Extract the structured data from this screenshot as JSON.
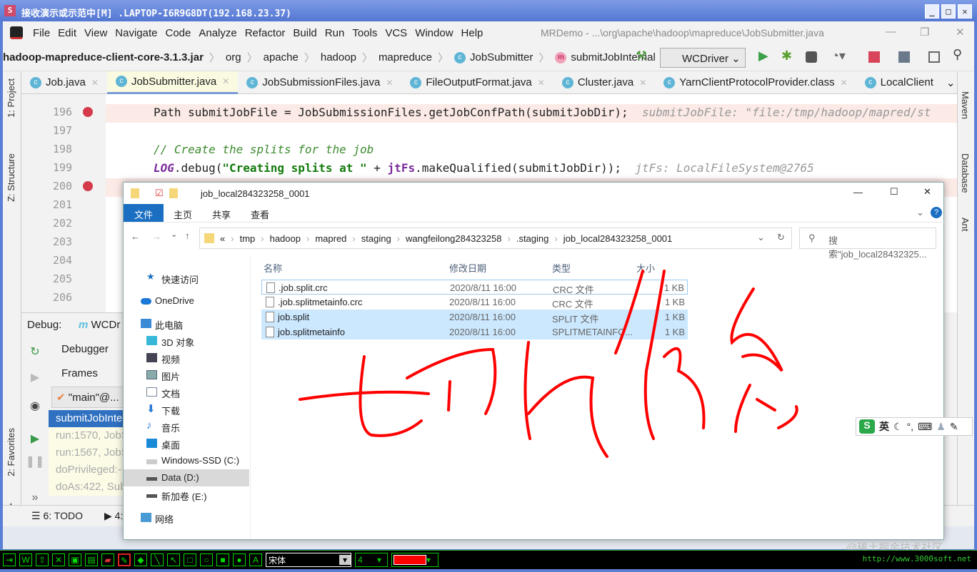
{
  "title": "接收演示或示范中[M] .LAPTOP-I6R9G8DT(192.168.23.37)",
  "menu": [
    "File",
    "Edit",
    "View",
    "Navigate",
    "Code",
    "Analyze",
    "Refactor",
    "Build",
    "Run",
    "Tools",
    "VCS",
    "Window",
    "Help"
  ],
  "project_path": "MRDemo - ...\\org\\apache\\hadoop\\mapreduce\\JobSubmitter.java",
  "breadcrumbs": [
    "hadoop-mapreduce-client-core-3.1.3.jar",
    "org",
    "apache",
    "hadoop",
    "mapreduce",
    "JobSubmitter",
    "submitJobInternal"
  ],
  "run_config": "WCDriver",
  "tabs": [
    "Job.java",
    "JobSubmitter.java",
    "JobSubmissionFiles.java",
    "FileOutputFormat.java",
    "Cluster.java",
    "YarnClientProtocolProvider.class",
    "LocalClient"
  ],
  "left_tools": [
    "1: Project",
    "Z: Structure",
    "2: Favorites"
  ],
  "right_tools": [
    "Maven",
    "Database",
    "Ant"
  ],
  "line_numbers": [
    "196",
    "197",
    "198",
    "199",
    "200",
    "201",
    "202",
    "203",
    "204",
    "205",
    "206"
  ],
  "code": {
    "l196": "Path submitJobFile = JobSubmissionFiles.getJobConfPath(submitJobDir);",
    "l196_hint": "submitJobFile: \"file:/tmp/hadoop/mapred/st",
    "l198": "// Create the splits for the job",
    "l199_a": "LOG",
    "l199_b": ".debug(",
    "l199_c": "\"Creating splits at \"",
    "l199_d": " + ",
    "l199_e": "jtFs",
    "l199_f": ".makeQualified(submitJobDir));",
    "l199_hint": "jtFs: LocalFileSystem@2765"
  },
  "debug": {
    "label": "Debug:",
    "config": "WCDr",
    "tab": "Debugger",
    "frames_label": "Frames",
    "thread": "\"main\"@...",
    "frames": [
      "submitJobInte",
      "run:1570, JobS",
      "run:1567, JobS",
      "doPrivileged:-",
      "doAs:422, Sub"
    ]
  },
  "bottom": {
    "todo": "6: TODO",
    "run": "4:"
  },
  "explorer": {
    "title": "job_local284323258_0001",
    "ribbon": [
      "文件",
      "主页",
      "共享",
      "查看"
    ],
    "path": [
      "tmp",
      "hadoop",
      "mapred",
      "staging",
      "wangfeilong284323258",
      ".staging",
      "job_local284323258_0001"
    ],
    "path_prefix": "«",
    "search_placeholder": "搜索\"job_local28432325...",
    "nav": [
      "快速访问",
      "OneDrive",
      "此电脑",
      "3D 对象",
      "视频",
      "图片",
      "文档",
      "下载",
      "音乐",
      "桌面",
      "Windows-SSD (C:)",
      "Data (D:)",
      "新加卷 (E:)",
      "网络"
    ],
    "columns": [
      "名称",
      "修改日期",
      "类型",
      "大小"
    ],
    "files": [
      {
        "name": ".job.split.crc",
        "date": "2020/8/11 16:00",
        "type": "CRC 文件",
        "size": "1 KB"
      },
      {
        "name": ".job.splitmetainfo.crc",
        "date": "2020/8/11 16:00",
        "type": "CRC 文件",
        "size": "1 KB"
      },
      {
        "name": "job.split",
        "date": "2020/8/11 16:00",
        "type": "SPLIT 文件",
        "size": "1 KB"
      },
      {
        "name": "job.splitmetainfo",
        "date": "2020/8/11 16:00",
        "type": "SPLITMETAINFO...",
        "size": "1 KB"
      }
    ]
  },
  "ime": {
    "lang": "英"
  },
  "drawbar": {
    "font": "宋体",
    "size": "4",
    "color": "#ff0000",
    "url": "http://www.3000soft.net"
  },
  "watermark": "@稀土掘金技术社区",
  "accent": "#1a6fc2"
}
